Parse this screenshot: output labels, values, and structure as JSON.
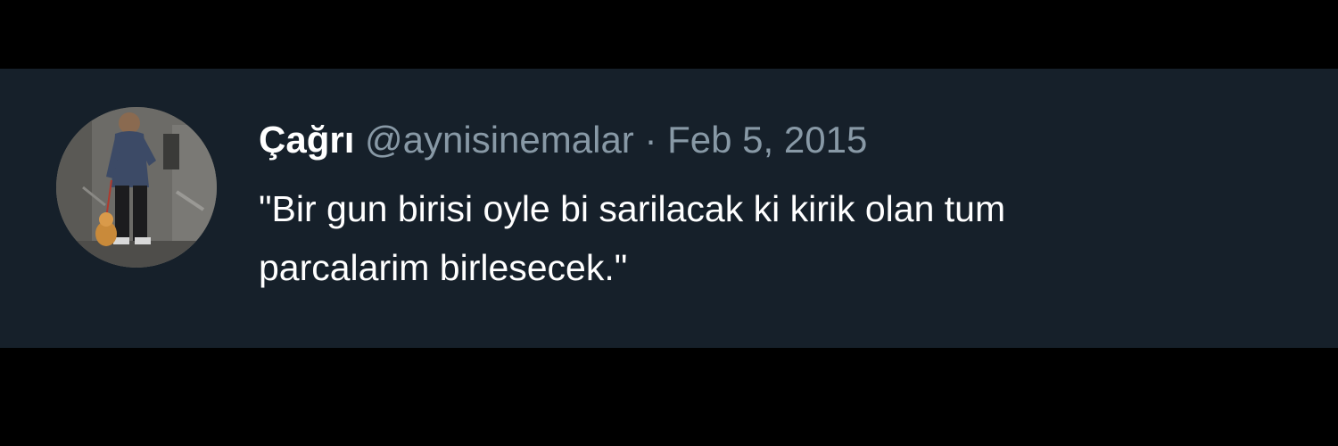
{
  "tweet": {
    "author": {
      "display_name": "Çağrı",
      "handle": "@aynisinemalar",
      "avatar_icon": "profile-photo"
    },
    "separator": " · ",
    "date": "Feb 5, 2015",
    "text": "\"Bir gun birisi oyle bi sarilacak ki kirik olan tum\nparcalarim birlesecek.\""
  },
  "colors": {
    "page_background": "#000000",
    "card_background": "#16202a",
    "primary_text": "#ffffff",
    "secondary_text": "#8899a6"
  }
}
